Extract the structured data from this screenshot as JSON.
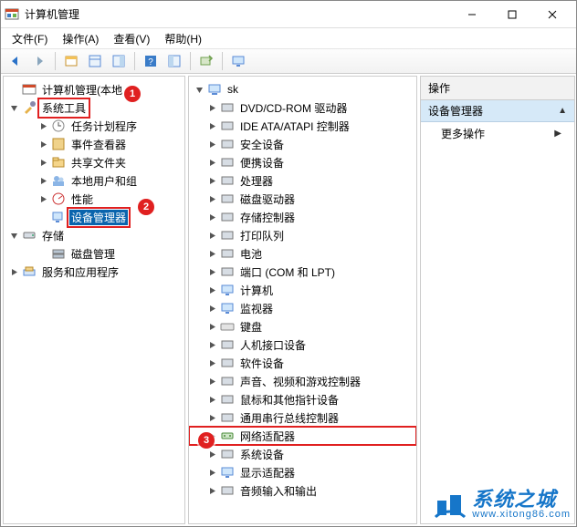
{
  "window": {
    "title": "计算机管理"
  },
  "menubar": [
    "文件(F)",
    "操作(A)",
    "查看(V)",
    "帮助(H)"
  ],
  "left_tree": {
    "root": {
      "label": "计算机管理(本地"
    },
    "system_tools": {
      "label": "系统工具",
      "children": [
        "任务计划程序",
        "事件查看器",
        "共享文件夹",
        "本地用户和组",
        "性能",
        "设备管理器"
      ]
    },
    "storage": {
      "label": "存储",
      "children": [
        "磁盘管理"
      ]
    },
    "services": {
      "label": "服务和应用程序"
    }
  },
  "device_tree": {
    "root": "sk",
    "children": [
      "DVD/CD-ROM 驱动器",
      "IDE ATA/ATAPI 控制器",
      "安全设备",
      "便携设备",
      "处理器",
      "磁盘驱动器",
      "存储控制器",
      "打印队列",
      "电池",
      "端口 (COM 和 LPT)",
      "计算机",
      "监视器",
      "键盘",
      "人机接口设备",
      "软件设备",
      "声音、视频和游戏控制器",
      "鼠标和其他指针设备",
      "通用串行总线控制器",
      "网络适配器",
      "系统设备",
      "显示适配器",
      "音频输入和输出"
    ]
  },
  "actions": {
    "header": "操作",
    "section": "设备管理器",
    "more": "更多操作"
  },
  "markers": {
    "m1": "1",
    "m2": "2",
    "m3": "3"
  },
  "watermark": {
    "brand": "系统之城",
    "url": "www.xitong86.com"
  },
  "icons": {
    "app": "mmc-icon",
    "back": "back-icon",
    "forward": "forward-icon",
    "up": "up-icon",
    "props": "properties-icon",
    "refresh": "refresh-icon",
    "help": "help-icon"
  }
}
